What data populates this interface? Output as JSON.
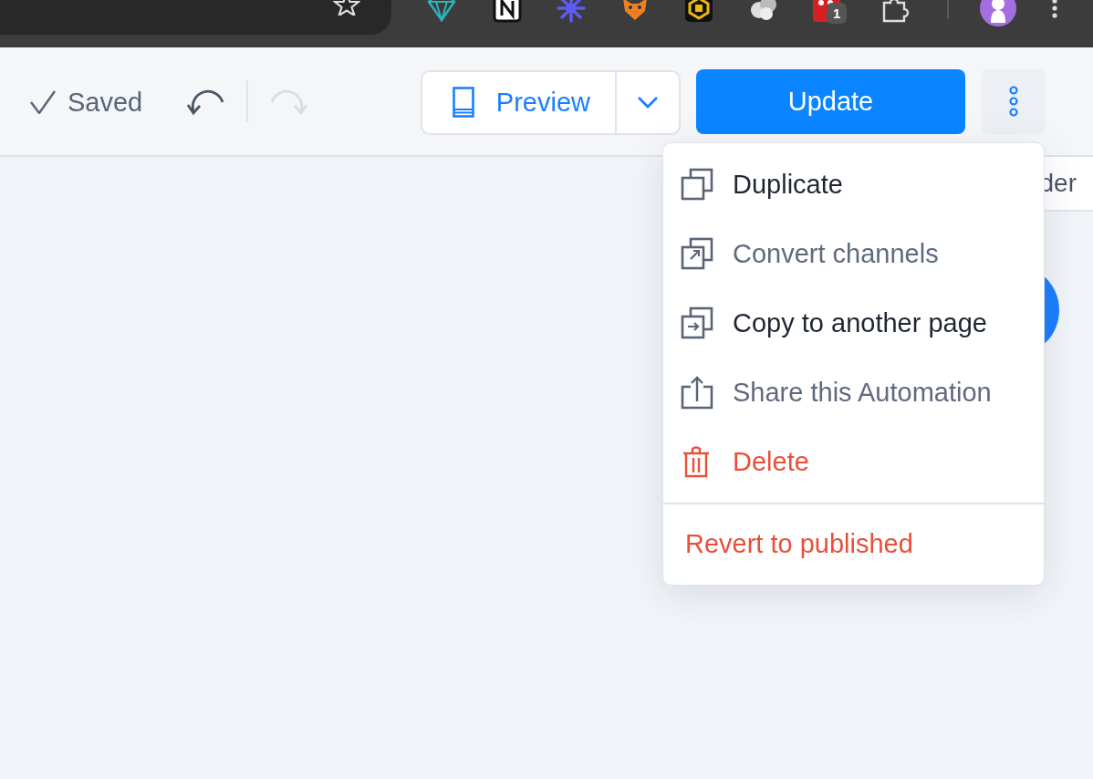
{
  "browser_toolbar": {
    "extension_badge": "1"
  },
  "header": {
    "save_status": "Saved",
    "undo": {
      "disabled": false
    },
    "redo": {
      "disabled": true
    },
    "preview_button": "Preview",
    "update_button": "Update"
  },
  "canvas": {
    "partial_button": "der"
  },
  "menu": {
    "items": [
      {
        "label": "Duplicate",
        "kind": "duplicate",
        "disabled": false
      },
      {
        "label": "Convert channels",
        "kind": "convert",
        "disabled": true
      },
      {
        "label": "Copy to another page",
        "kind": "copy",
        "disabled": false
      },
      {
        "label": "Share this Automation",
        "kind": "share",
        "disabled": true
      },
      {
        "label": "Delete",
        "kind": "delete",
        "disabled": false
      }
    ],
    "footer_item": "Revert to published"
  }
}
